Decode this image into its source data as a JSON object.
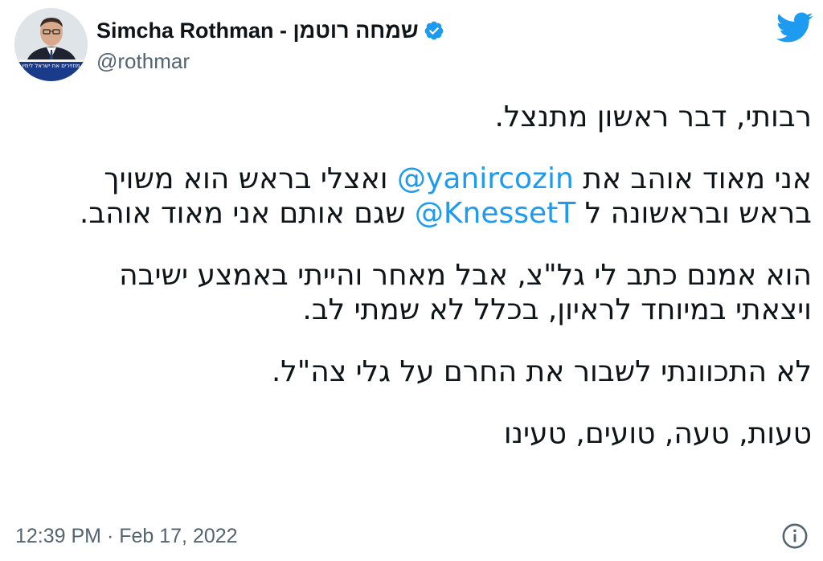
{
  "author": {
    "display_name": "Simcha Rothman - שמחה רוטמן",
    "handle": "@rothmar",
    "verified": true,
    "avatar_banner_text": "מחזירים את ישראל לימין"
  },
  "tweet": {
    "lines": {
      "l1": "רבותי, דבר ראשון מתנצל.",
      "l2_before": "אני מאוד אוהב את ",
      "l2_mention": "@yanircozin",
      "l2_after": " ואצלי בראש הוא משויך",
      "l3_before": "בראש ובראשונה ל ",
      "l3_mention": "@KnessetT",
      "l3_after": " שגם אותם אני מאוד אוהב.",
      "l4": "הוא אמנם כתב לי גל\"צ, אבל מאחר והייתי באמצע ישיבה",
      "l5": "ויצאתי במיוחד לראיון, בכלל לא שמתי לב.",
      "l6": "לא התכוונתי לשבור את החרם על גלי צה\"ל.",
      "l7": "טעות, טעה, טועים, טעינו"
    },
    "timestamp": "12:39 PM · Feb 17, 2022"
  },
  "icons": {
    "brand": "twitter-bird-icon",
    "verified": "verified-badge-icon",
    "info": "info-icon"
  },
  "colors": {
    "twitter_blue": "#1d9bf0",
    "text_primary": "#0f1419",
    "text_secondary": "#536471",
    "avatar_banner": "#1a3a8a"
  }
}
